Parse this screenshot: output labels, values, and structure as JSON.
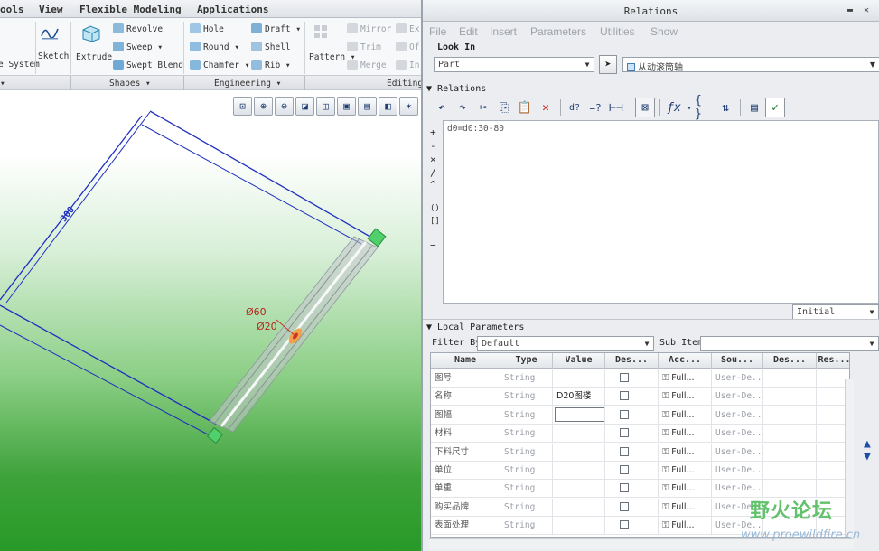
{
  "cad": {
    "tabs": [
      "ools",
      "View",
      "Flexible Modeling",
      "Applications"
    ],
    "ribbon": {
      "system": "System",
      "sketch": "Sketch",
      "extrude": "Extrude",
      "revolve": "Revolve",
      "sweep": "Sweep",
      "swept_blend": "Swept Blend",
      "hole": "Hole",
      "round": "Round",
      "chamfer": "Chamfer",
      "draft": "Draft",
      "shell": "Shell",
      "rib": "Rib",
      "pattern": "Pattern",
      "mirror": "Mirror",
      "trim": "Trim",
      "merge": "Merge",
      "ex": "Ex",
      "of": "Of",
      "in": "In"
    },
    "groups": {
      "shapes": "Shapes ▾",
      "engineering": "Engineering ▾",
      "editing": "Editing"
    },
    "dims": {
      "length": "300",
      "d60": "Ø60",
      "d20": "Ø20"
    }
  },
  "dialog": {
    "title": "Relations",
    "menu": [
      "File",
      "Edit",
      "Insert",
      "Parameters",
      "Utilities",
      "Show"
    ],
    "look_in_label": "Look In",
    "look_in_type": "Part",
    "look_in_item": "从动滚筒轴",
    "relations_label": "Relations",
    "relation_text": "d0=d0:30-80",
    "left_symbols": [
      "+",
      "-",
      "×",
      "/",
      "^",
      "()",
      "[]",
      "="
    ],
    "initial": "Initial",
    "local_params_label": "Local Parameters",
    "filter_label": "Filter By",
    "filter_value": "Default",
    "sub_items_label": "Sub Items",
    "columns": [
      "Name",
      "Type",
      "Value",
      "Des...",
      "Acc...",
      "Sou...",
      "Des...",
      "Res..."
    ],
    "rows": [
      {
        "name": "图号",
        "type": "String",
        "value": "",
        "access": "Full...",
        "source": "User-De..."
      },
      {
        "name": "名称",
        "type": "String",
        "value": "D20图楼",
        "access": "Full...",
        "source": "User-De..."
      },
      {
        "name": "图幅",
        "type": "String",
        "value": "",
        "access": "Full...",
        "source": "User-De..."
      },
      {
        "name": "材料",
        "type": "String",
        "value": "",
        "access": "Full...",
        "source": "User-De..."
      },
      {
        "name": "下料尺寸",
        "type": "String",
        "value": "",
        "access": "Full...",
        "source": "User-De..."
      },
      {
        "name": "单位",
        "type": "String",
        "value": "",
        "access": "Full...",
        "source": "User-De..."
      },
      {
        "name": "单重",
        "type": "String",
        "value": "",
        "access": "Full...",
        "source": "User-De..."
      },
      {
        "name": "购买品牌",
        "type": "String",
        "value": "",
        "access": "Full...",
        "source": "User-De..."
      },
      {
        "name": "表面处理",
        "type": "String",
        "value": "",
        "access": "Full...",
        "source": "User-De..."
      }
    ]
  },
  "watermark": {
    "text": "野火论坛",
    "url": "www.proewildfire.cn"
  }
}
